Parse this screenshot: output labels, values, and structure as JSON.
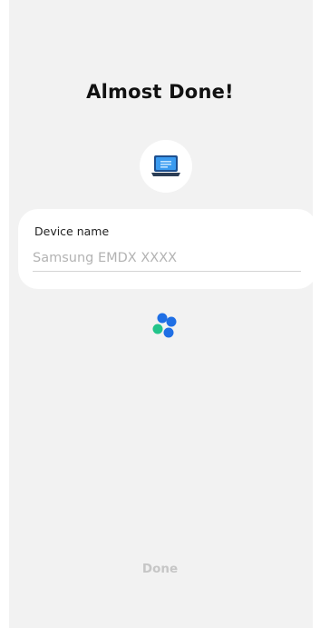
{
  "page": {
    "title": "Almost Done!"
  },
  "device_icon": "laptop-icon",
  "device_name": {
    "label": "Device name",
    "placeholder": "Samsung EMDX XXXX",
    "value": ""
  },
  "loading_icon": "loading-spinner-icon",
  "footer": {
    "done_label": "Done",
    "done_enabled": false
  },
  "colors": {
    "background": "#f2f2f2",
    "card": "#ffffff",
    "spinner_blue": "#1f6fe5",
    "spinner_green": "#23c48a",
    "done_disabled": "#c6c6c6"
  }
}
